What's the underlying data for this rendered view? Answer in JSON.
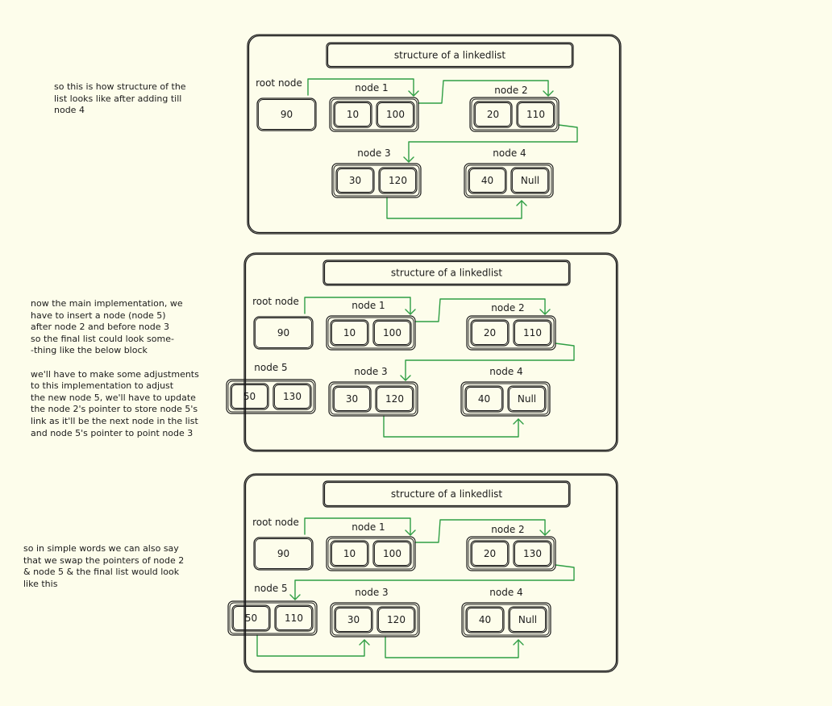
{
  "notes": {
    "note_1": "so this is how structure of the\nlist looks like after adding till\nnode 4",
    "note_2": "now the main implementation, we\nhave to insert a node (node 5)\nafter node 2 and before node 3\nso the final list could look some-\n-thing like the below block\n\nwe'll have to make some adjustments\nto this implementation to adjust\nthe new node 5, we'll have to update\nthe node 2's pointer to store node 5's\nlink as it'll be the next node in the list\nand node 5's pointer to point node 3",
    "note_3": "so in simple words we can also say\nthat we swap the pointers of node 2\n& node 5 & the final list would look\nlike this"
  },
  "colors": {
    "background": "#fdfdeb",
    "ink": "#1b1b1b",
    "arrow": "#2f9e44"
  },
  "panels": [
    {
      "title": "structure of a linkedlist",
      "root": {
        "label": "root node",
        "value": "90"
      },
      "nodes": [
        {
          "label": "node 1",
          "data": "10",
          "next": "100"
        },
        {
          "label": "node 2",
          "data": "20",
          "next": "110"
        },
        {
          "label": "node 3",
          "data": "30",
          "next": "120"
        },
        {
          "label": "node 4",
          "data": "40",
          "next": "Null"
        }
      ],
      "links": [
        [
          "root",
          "node 1"
        ],
        [
          "node 1",
          "node 2"
        ],
        [
          "node 2",
          "node 3"
        ],
        [
          "node 3",
          "node 4"
        ]
      ]
    },
    {
      "title": "structure of a linkedlist",
      "root": {
        "label": "root node",
        "value": "90"
      },
      "nodes": [
        {
          "label": "node 1",
          "data": "10",
          "next": "100"
        },
        {
          "label": "node 2",
          "data": "20",
          "next": "110"
        },
        {
          "label": "node 5",
          "data": "50",
          "next": "130"
        },
        {
          "label": "node 3",
          "data": "30",
          "next": "120"
        },
        {
          "label": "node 4",
          "data": "40",
          "next": "Null"
        }
      ],
      "links": [
        [
          "root",
          "node 1"
        ],
        [
          "node 1",
          "node 2"
        ],
        [
          "node 2",
          "node 3"
        ],
        [
          "node 3",
          "node 4"
        ]
      ]
    },
    {
      "title": "structure of a linkedlist",
      "root": {
        "label": "root node",
        "value": "90"
      },
      "nodes": [
        {
          "label": "node 1",
          "data": "10",
          "next": "100"
        },
        {
          "label": "node 2",
          "data": "20",
          "next": "130"
        },
        {
          "label": "node 5",
          "data": "50",
          "next": "110"
        },
        {
          "label": "node 3",
          "data": "30",
          "next": "120"
        },
        {
          "label": "node 4",
          "data": "40",
          "next": "Null"
        }
      ],
      "links": [
        [
          "root",
          "node 1"
        ],
        [
          "node 1",
          "node 2"
        ],
        [
          "node 2",
          "node 5"
        ],
        [
          "node 5",
          "node 3"
        ],
        [
          "node 3",
          "node 4"
        ]
      ]
    }
  ]
}
